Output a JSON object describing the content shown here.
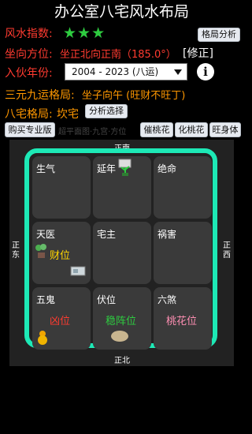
{
  "title": "办公室八宅风水布局",
  "fengshui_index_label": "风水指数:",
  "stars": [
    "★",
    "★",
    "★"
  ],
  "pattern_button": "格局分析",
  "facing_label": "坐向方位:",
  "facing_value": "坐正北向正南（185.0°）",
  "correct_label": "[修正]",
  "year_label": "入伙年份:",
  "year_value": "2004 - 2023 (八运)",
  "info_glyph": "i",
  "sanyuan_label": "三元九运格局:",
  "sanyuan_value": "坐子向午 (旺财不旺丁)",
  "bazhai_label": "八宅格局:",
  "bazhai_value": "坎宅",
  "analyze_button": "分析选择",
  "buttons": {
    "buy": "购买专业版",
    "cuitao": "催桃花",
    "huatao": "化桃花",
    "wangshen": "旺身体"
  },
  "hidden_text": "超平面图·九宫·方位",
  "directions": {
    "top": "正南",
    "bottom": "正北",
    "left": "正东",
    "right": "正西"
  },
  "cells": [
    {
      "label": "生气",
      "extra": ""
    },
    {
      "label": "延年",
      "extra": ""
    },
    {
      "label": "绝命",
      "extra": ""
    },
    {
      "label": "天医",
      "extra": "财位"
    },
    {
      "label": "宅主",
      "extra": ""
    },
    {
      "label": "祸害",
      "extra": ""
    },
    {
      "label": "五鬼",
      "extra": "凶位"
    },
    {
      "label": "伏位",
      "extra": "稳阵位"
    },
    {
      "label": "六煞",
      "extra": "桃花位"
    }
  ],
  "colors": {
    "accent": "#1de9b6",
    "red": "#ff3b30",
    "orange": "#ff9800",
    "yellow": "#ffd600",
    "green": "#2ecc40",
    "pink": "#ff8fb3"
  }
}
